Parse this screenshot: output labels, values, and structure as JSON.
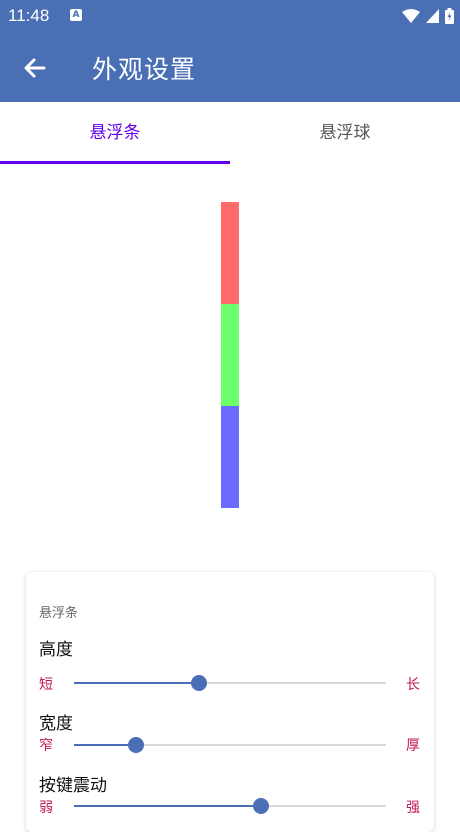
{
  "status": {
    "time": "11:48",
    "notif_icon": "A",
    "icons": [
      "wifi-icon",
      "signal-icon",
      "battery-icon"
    ]
  },
  "appbar": {
    "title": "外观设置",
    "back_icon": "arrow-left-icon"
  },
  "tabs": [
    {
      "label": "悬浮条",
      "active": true
    },
    {
      "label": "悬浮球",
      "active": false
    }
  ],
  "preview": {
    "colors": [
      "#ff6b6b",
      "#6bff6b",
      "#6b6bff"
    ]
  },
  "card": {
    "section_title": "悬浮条",
    "sliders": [
      {
        "label": "高度",
        "min_label": "短",
        "max_label": "长",
        "value": 0.4
      },
      {
        "label": "宽度",
        "min_label": "窄",
        "max_label": "厚",
        "value": 0.2
      },
      {
        "label": "按键震动",
        "min_label": "弱",
        "max_label": "强",
        "value": 0.6
      }
    ]
  },
  "colors": {
    "primary": "#4a6fb5",
    "accent": "#6200ee",
    "slider_text": "#c2185b"
  }
}
